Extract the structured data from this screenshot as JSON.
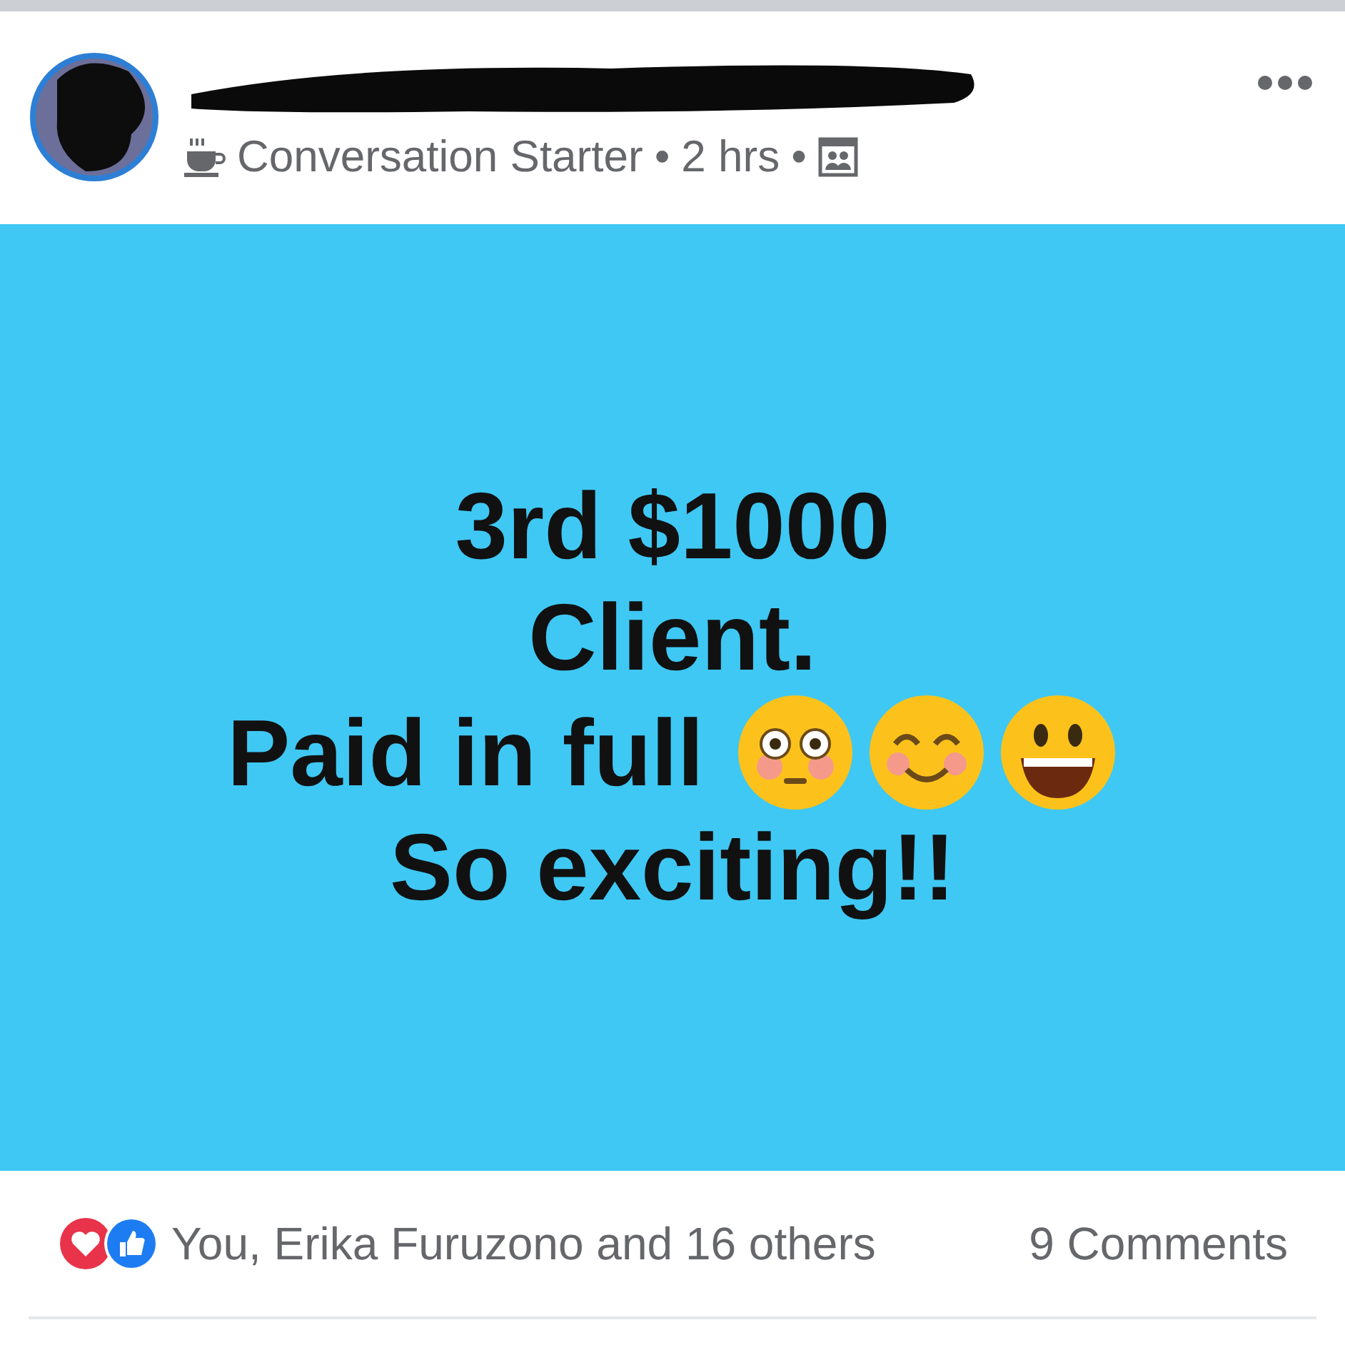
{
  "post": {
    "badge": "Conversation Starter",
    "separator_1": "•",
    "time": "2 hrs",
    "separator_2": "•",
    "body_lines": [
      {
        "kind": "text",
        "text": "3rd $1000"
      },
      {
        "kind": "text",
        "text": "Client."
      },
      {
        "kind": "emojis",
        "text": "Paid in full"
      },
      {
        "kind": "text",
        "text": "So exciting!!"
      }
    ],
    "reactions_text": "You, Erika Furuzono and 16 others",
    "comments": "9 Comments"
  }
}
